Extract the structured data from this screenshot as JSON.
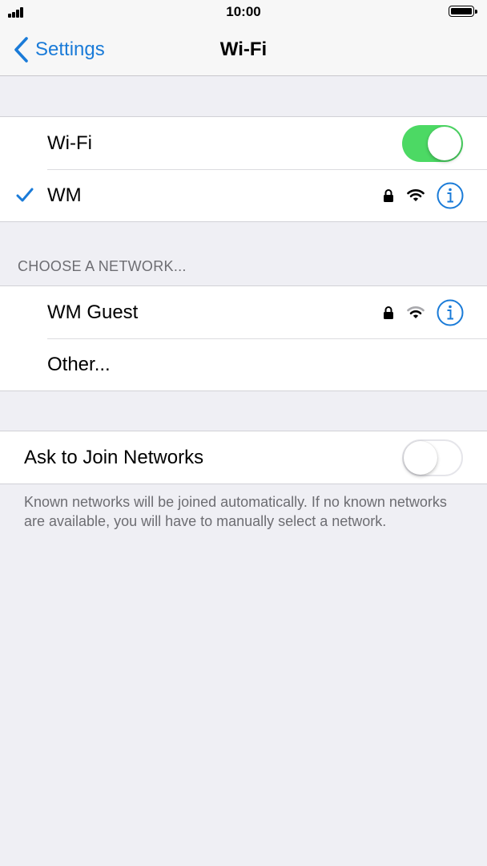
{
  "status_bar": {
    "time": "10:00"
  },
  "nav": {
    "back_label": "Settings",
    "title": "Wi-Fi"
  },
  "wifi_section": {
    "wifi_label": "Wi-Fi",
    "wifi_enabled": true,
    "connected_network": {
      "name": "WM",
      "secured": true,
      "selected": true
    }
  },
  "choose_network": {
    "header": "CHOOSE A NETWORK...",
    "networks": [
      {
        "name": "WM Guest",
        "secured": true
      },
      {
        "name": "Other...",
        "secured": false
      }
    ]
  },
  "ask_to_join": {
    "label": "Ask to Join Networks",
    "enabled": false,
    "footer": "Known networks will be joined automatically. If no known networks are available, you will have to manually select a network."
  },
  "colors": {
    "accent": "#1a7bd8",
    "toggle_on": "#4cd964",
    "background": "#efeff4"
  }
}
